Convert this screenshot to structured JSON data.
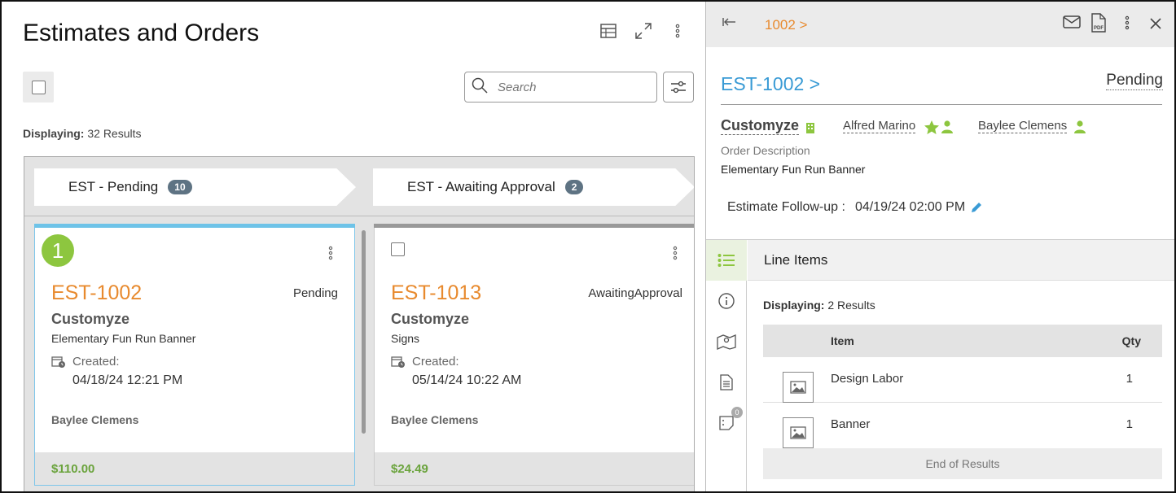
{
  "left": {
    "title": "Estimates and Orders",
    "search_placeholder": "Search",
    "displaying_label": "Displaying:",
    "displaying_value": "32 Results",
    "stages": [
      {
        "label": "EST - Pending",
        "count": "10"
      },
      {
        "label": "EST - Awaiting Approval",
        "count": "2"
      }
    ],
    "cards": [
      {
        "badge": "1",
        "id": "EST-1002",
        "status": "Pending",
        "customer": "Customyze",
        "description": "Elementary Fun Run Banner",
        "created_label": "Created:",
        "created": "04/18/24 12:21 PM",
        "owner": "Baylee Clemens",
        "total": "$110.00",
        "accent": "#6ec3e8"
      },
      {
        "id": "EST-1013",
        "status": "AwaitingApproval",
        "customer": "Customyze",
        "description": "Signs",
        "created_label": "Created:",
        "created": "05/14/24 10:22 AM",
        "owner": "Baylee Clemens",
        "total": "$24.49",
        "accent": "#999999"
      }
    ]
  },
  "right": {
    "breadcrumb": "1002 >",
    "title": "EST-1002 >",
    "status": "Pending",
    "customer": "Customyze",
    "contact": "Alfred Marino",
    "salesperson": "Baylee Clemens",
    "order_desc_label": "Order Description",
    "order_desc": "Elementary Fun Run Banner",
    "followup_label": "Estimate Follow-up :",
    "followup_value": "04/19/24 02:00 PM",
    "notes_count": "0",
    "line_items": {
      "heading": "Line Items",
      "displaying_label": "Displaying:",
      "displaying_value": "2 Results",
      "col_item": "Item",
      "col_qty": "Qty",
      "rows": [
        {
          "item": "Design Labor",
          "qty": "1"
        },
        {
          "item": "Banner",
          "qty": "1"
        }
      ],
      "end_text": "End of Results"
    }
  },
  "colors": {
    "accent_orange": "#e88a2e",
    "link_blue": "#3a9bd5",
    "green": "#8dc63f",
    "total_green": "#6aa33c"
  }
}
